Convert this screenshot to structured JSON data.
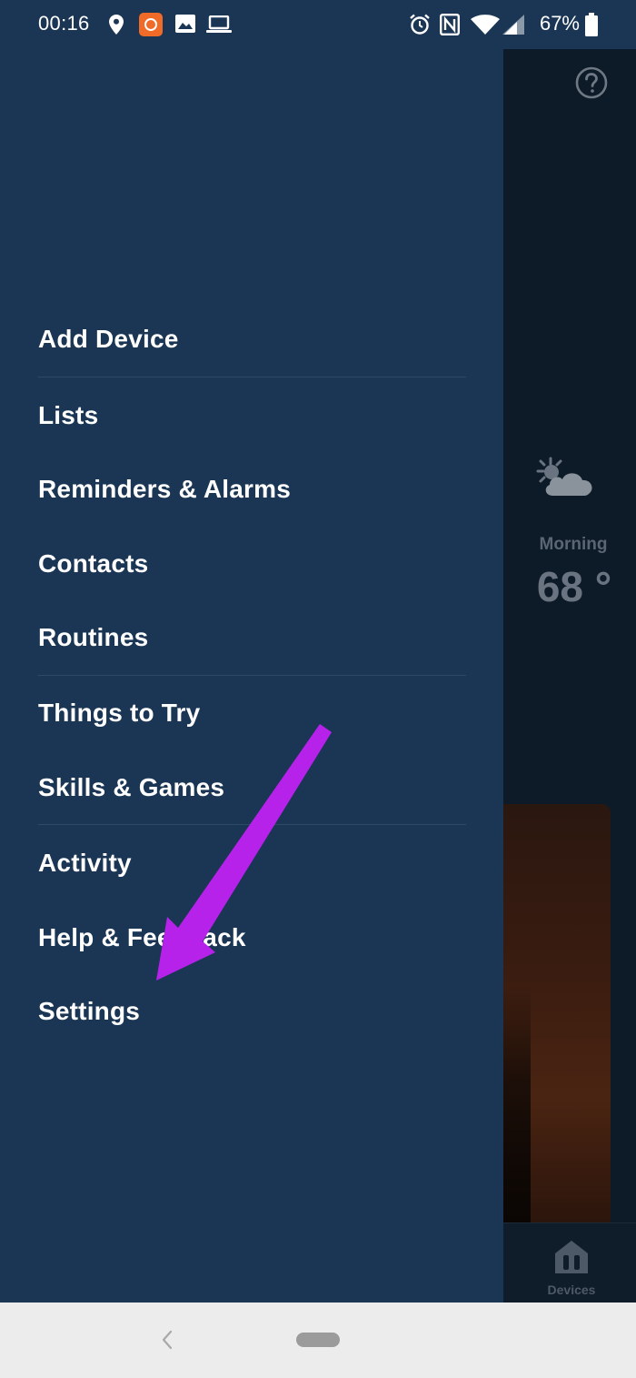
{
  "status_bar": {
    "time": "00:16",
    "battery": "67%",
    "icons": [
      "location-icon",
      "app-notification-icon",
      "image-icon",
      "laptop-icon",
      "alarm-icon",
      "nfc-icon",
      "wifi-icon",
      "cellular-signal-icon",
      "battery-icon"
    ]
  },
  "drawer": {
    "items": [
      {
        "label": "Add Device"
      },
      {
        "label": "Lists"
      },
      {
        "label": "Reminders & Alarms"
      },
      {
        "label": "Contacts"
      },
      {
        "label": "Routines"
      },
      {
        "label": "Things to Try"
      },
      {
        "label": "Skills & Games"
      },
      {
        "label": "Activity"
      },
      {
        "label": "Help & Feedback"
      },
      {
        "label": "Settings"
      }
    ]
  },
  "background": {
    "weather_label": "Morning",
    "weather_temp": "68 °",
    "devices_label": "Devices"
  },
  "colors": {
    "drawer_bg": "#1a3654",
    "app_bg": "#0d1a27",
    "annotation_arrow": "#b622ea"
  }
}
